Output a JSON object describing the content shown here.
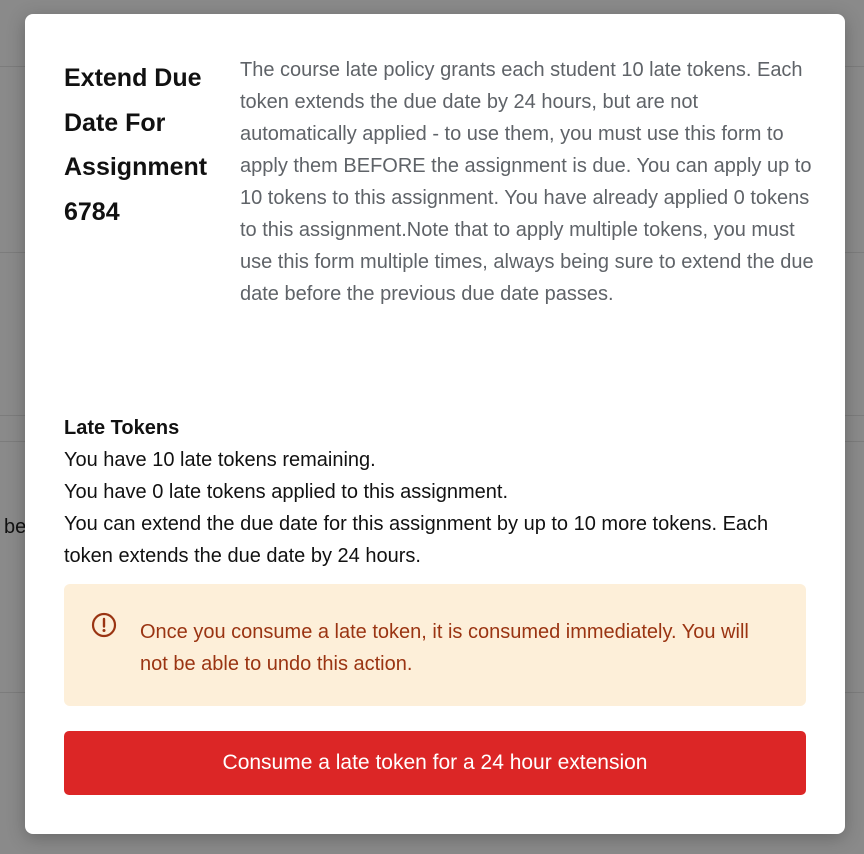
{
  "background": {
    "partial_text": "l be"
  },
  "dialog": {
    "title": "Extend Due Date For Assignment 6784",
    "description": "The course late policy grants each student 10 late tokens. Each token extends the due date by 24 hours, but are not automatically applied - to use them, you must use this form to apply them BEFORE the assignment is due. You can apply up to 10 tokens to this assignment. You have already applied 0 tokens to this assignment.Note that to apply multiple tokens, you must use this form multiple times, always being sure to extend the due date before the previous due date passes.",
    "late_tokens": {
      "heading": "Late Tokens",
      "remaining": "You have 10 late tokens remaining.",
      "applied": "You have 0 late tokens applied to this assignment.",
      "can_extend": "You can extend the due date for this assignment by up to 10 more tokens. Each token extends the due date by 24 hours."
    },
    "warning": {
      "icon": "alert-circle-icon",
      "text": "Once you consume a late token, it is consumed immediately. You will not be able to undo this action."
    },
    "consume_button_label": "Consume a late token for a 24 hour extension"
  },
  "colors": {
    "button_background": "#dc2626",
    "warning_background": "#fdefd9",
    "warning_text": "#9a3412"
  }
}
